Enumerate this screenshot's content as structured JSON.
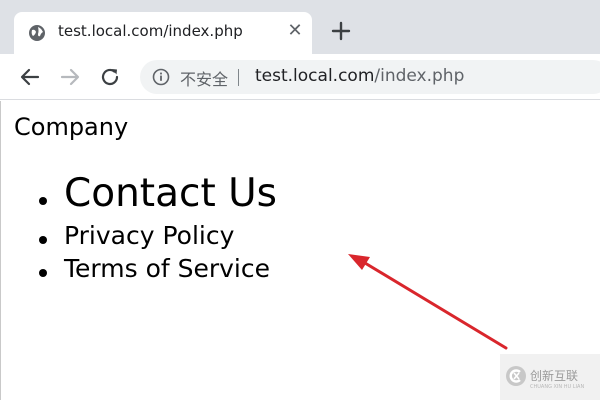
{
  "browser": {
    "tab": {
      "title": "test.local.com/index.php",
      "close_symbol": "✕"
    },
    "toolbar": {
      "security_label": "不安全",
      "url_host": "test.local.com",
      "url_path": "/index.php"
    },
    "icons": {
      "tab": "globe-icon",
      "close": "close-icon",
      "new_tab": "plus-icon",
      "back": "back-arrow-icon",
      "forward": "forward-arrow-icon",
      "reload": "reload-icon",
      "info": "info-icon"
    },
    "colors": {
      "tabstrip": "#dee1e6",
      "omnibox": "#f1f3f4",
      "annotation_arrow": "#d9262c"
    }
  },
  "page": {
    "site_title": "Company",
    "menu": {
      "items": [
        {
          "label": "Contact Us"
        },
        {
          "label": "Privacy Policy"
        },
        {
          "label": "Terms of Service"
        }
      ]
    }
  },
  "watermark": {
    "text": "创新互联",
    "subtext": "CHUANG XIN HU LIAN"
  }
}
